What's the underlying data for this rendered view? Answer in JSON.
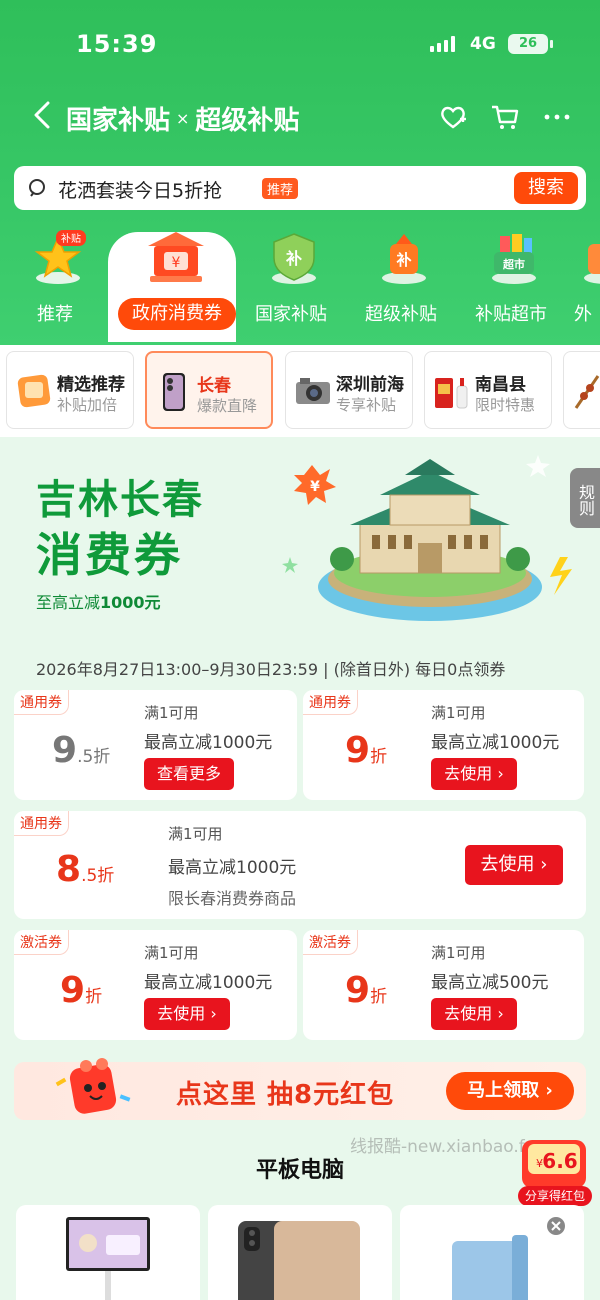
{
  "status": {
    "time": "15:39",
    "network": "4G",
    "battery": "26"
  },
  "nav": {
    "title_left": "国家补贴",
    "separator": "×",
    "title_right": "超级补贴"
  },
  "search": {
    "placeholder": "花洒套装今日5折抢",
    "tag": "推荐",
    "button": "搜索"
  },
  "categories": [
    {
      "label": "推荐",
      "icon": "star-subsidy-icon",
      "badge": "补贴"
    },
    {
      "label": "政府消费券",
      "icon": "government-building-icon",
      "active": true
    },
    {
      "label": "国家补贴",
      "icon": "shield-subsidy-icon"
    },
    {
      "label": "超级补贴",
      "icon": "super-subsidy-icon"
    },
    {
      "label": "补贴超市",
      "icon": "supermarket-basket-icon"
    },
    {
      "label": "外"
    }
  ],
  "sub_tabs": [
    {
      "title": "精选推荐",
      "subtitle": "补贴加倍"
    },
    {
      "title": "长春",
      "subtitle": "爆款直降",
      "active": true
    },
    {
      "title": "深圳前海",
      "subtitle": "专享补贴"
    },
    {
      "title": "南昌县",
      "subtitle": "限时特惠"
    }
  ],
  "banner": {
    "title1": "吉林长春",
    "title2": "消费券",
    "subtitle_prefix": "至高立减",
    "subtitle_amount": "1000元",
    "rules": "规则"
  },
  "period": "2026年8月27日13:00–9月30日23:59 | (除首日外) 每日0点领券",
  "coupons": [
    {
      "tag": "通用券",
      "rate_big": "9",
      "rate_small": ".5折",
      "cond": "满1可用",
      "desc": "最高立减1000元",
      "button": "查看更多"
    },
    {
      "tag": "通用券",
      "rate_big": "9",
      "rate_small": "折",
      "cond": "满1可用",
      "desc": "最高立减1000元",
      "button": "去使用 ›"
    },
    {
      "tag": "通用券",
      "rate_big": "8",
      "rate_small": ".5折",
      "cond": "满1可用",
      "desc": "最高立减1000元",
      "note": "限长春消费券商品",
      "button": "去使用 ›"
    },
    {
      "tag": "激活券",
      "rate_big": "9",
      "rate_small": "折",
      "cond": "满1可用",
      "desc": "最高立减1000元",
      "button": "去使用 ›"
    },
    {
      "tag": "激活券",
      "rate_big": "9",
      "rate_small": "折",
      "cond": "满1可用",
      "desc": "最高立减500元",
      "button": "去使用 ›"
    }
  ],
  "lottery": {
    "text": "点这里 抽8元红包",
    "button": "马上领取 ›"
  },
  "watermark": "线报酷-new.xianbao.fun",
  "share": {
    "amount": "6.6",
    "currency": "¥",
    "label": "分享得红包"
  },
  "section_title": "平板电脑",
  "colors": {
    "brand_green": "#2fbf5a",
    "accent_red": "#e8141e",
    "accent_orange": "#ff4a0a"
  }
}
